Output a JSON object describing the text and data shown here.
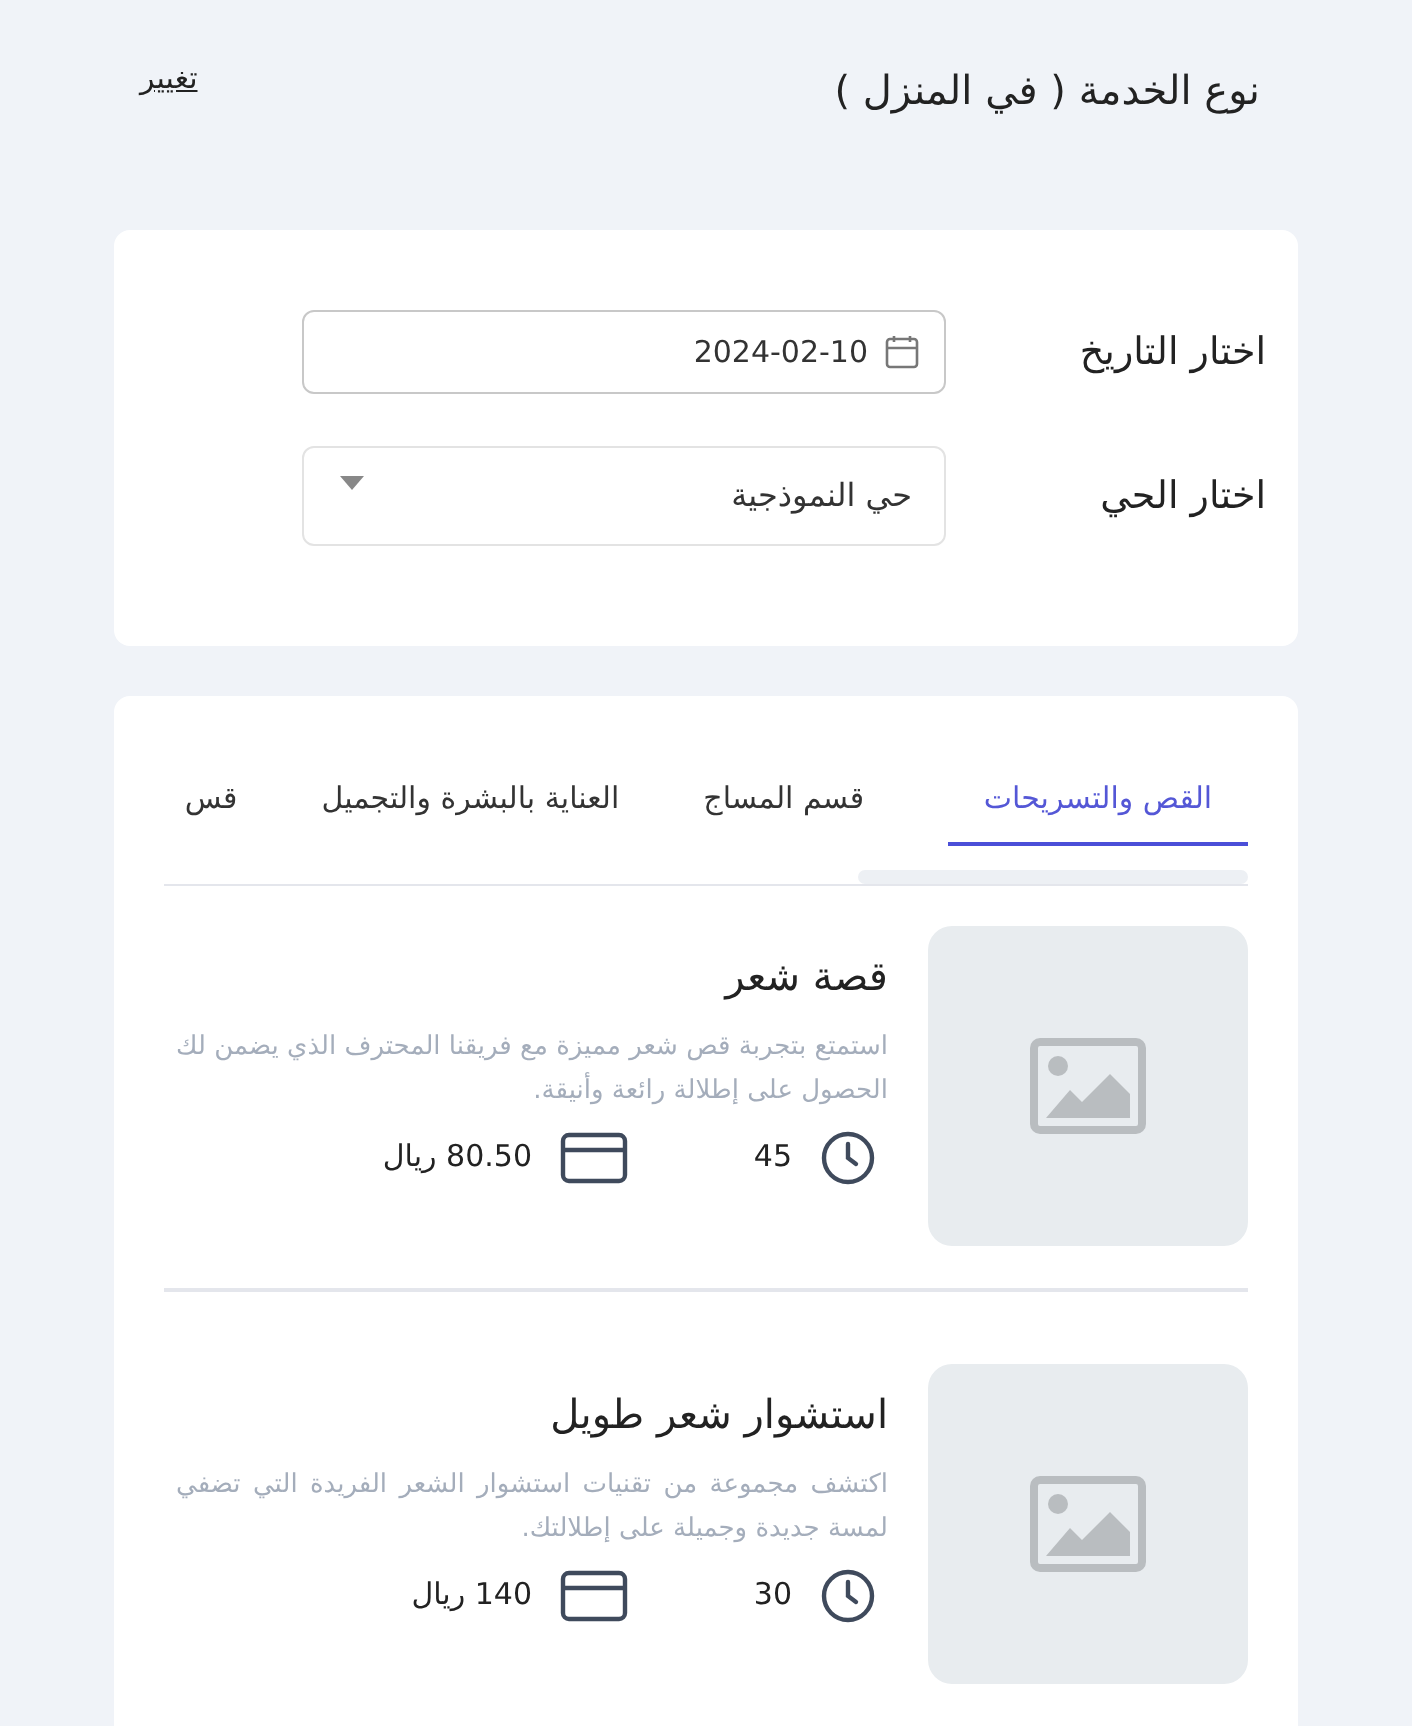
{
  "header": {
    "title": "نوع الخدمة ( في المنزل )",
    "change_link": "تغيير"
  },
  "booking_form": {
    "date_label": "اختار التاريخ",
    "date_value": "2024-02-10",
    "district_label": "اختار الحي",
    "district_value": "حي النموذجية"
  },
  "tabs": [
    {
      "label": "القص والتسريحات",
      "selected": true
    },
    {
      "label": "قسم المساج",
      "selected": false
    },
    {
      "label": "العناية بالبشرة والتجميل",
      "selected": false
    },
    {
      "label": "قس",
      "selected": false
    }
  ],
  "services": [
    {
      "name": "قصة شعر",
      "description": "استمتع بتجربة قص شعر مميزة مع فريقنا المحترف الذي يضمن لك الحصول على إطلالة رائعة وأنيقة.",
      "duration": "45",
      "price": "80.50 ريال"
    },
    {
      "name": "استشوار شعر طويل",
      "description": "اكتشف مجموعة من تقنيات استشوار الشعر الفريدة التي تضفي لمسة جديدة وجميلة على إطلالتك.",
      "duration": "30",
      "price": "140 ريال"
    }
  ]
}
